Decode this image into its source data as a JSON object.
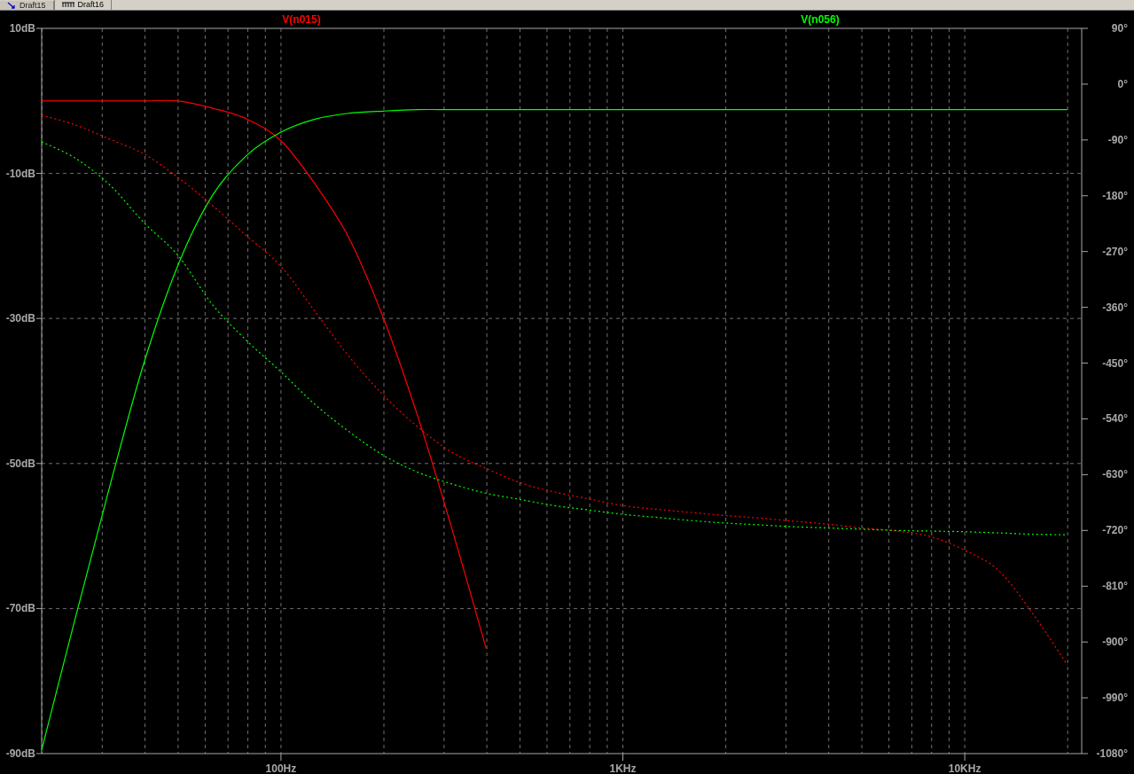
{
  "tabs": [
    {
      "label": "Draft15",
      "kind": "schematic",
      "selected": false
    },
    {
      "label": "Draft16",
      "kind": "netlist",
      "selected": true
    }
  ],
  "plot": {
    "magnitude": {
      "chart_data": {
        "type": "line",
        "grid": true,
        "ylim": [
          -90,
          10
        ],
        "yticks": [
          {
            "value": 10,
            "label": "10dB"
          },
          {
            "value": -10,
            "label": "-10dB"
          },
          {
            "value": -30,
            "label": "-30dB"
          },
          {
            "value": -50,
            "label": "-50dB"
          },
          {
            "value": -70,
            "label": "-70dB"
          },
          {
            "value": -90,
            "label": "-90dB"
          }
        ],
        "categories": [
          null,
          null,
          null,
          null,
          null,
          null,
          null,
          "100Hz",
          null,
          null,
          null,
          null,
          null,
          null,
          null,
          null,
          null,
          "1KHz",
          null,
          null,
          null,
          null,
          null,
          null,
          null,
          null,
          null,
          "10KHz",
          null,
          null,
          null
        ],
        "series": [
          {
            "name": "V(n015)",
            "color": "#ff0000",
            "values": [
              0,
              0,
              0,
              0,
              0,
              -1,
              -2.5,
              -5.5,
              -11.5,
              -19,
              -30,
              -43.5,
              -59,
              -75.5,
              null,
              null,
              null,
              null,
              null,
              null,
              null,
              null,
              null,
              null,
              null,
              null,
              null,
              null,
              null,
              null,
              null
            ]
          },
          {
            "name": "V(n056)",
            "color": "#00ff00",
            "values": [
              -89.5,
              -71,
              -53,
              -36,
              -22.5,
              -13,
              -7.5,
              -4.3,
              -2.5,
              -1.7,
              -1.4,
              -1.2,
              -1.2,
              -1.2,
              -1.2,
              -1.2,
              -1.2,
              -1.2,
              -1.2,
              -1.2,
              -1.2,
              -1.2,
              -1.2,
              -1.2,
              -1.2,
              -1.2,
              -1.2,
              -1.2,
              -1.2,
              -1.2,
              -1.2
            ]
          }
        ]
      }
    },
    "phase": {
      "chart_data": {
        "type": "line",
        "ylim": [
          -1080,
          90
        ],
        "yticks": [
          {
            "value": 90,
            "label": "90°"
          },
          {
            "value": 0,
            "label": "0°"
          },
          {
            "value": -90,
            "label": "-90°"
          },
          {
            "value": -180,
            "label": "-180°"
          },
          {
            "value": -270,
            "label": "-270°"
          },
          {
            "value": -360,
            "label": "-360°"
          },
          {
            "value": -450,
            "label": "-450°"
          },
          {
            "value": -540,
            "label": "-540°"
          },
          {
            "value": -630,
            "label": "-630°"
          },
          {
            "value": -720,
            "label": "-720°"
          },
          {
            "value": -810,
            "label": "-810°"
          },
          {
            "value": -900,
            "label": "-900°"
          },
          {
            "value": -990,
            "label": "-990°"
          },
          {
            "value": -1080,
            "label": "-1080°"
          }
        ],
        "series": [
          {
            "color": "#ff0000",
            "line_style": "dashed",
            "values": [
              -50,
              -66,
              -89,
              -113,
              -151,
              -196,
              -245,
              -294,
              -367,
              -440,
              -502,
              -553,
              -594,
              -620,
              -643,
              -658,
              -669,
              -680,
              -686,
              -691,
              -696,
              -700,
              -705,
              -710,
              -716,
              -721,
              -730,
              -752,
              -785,
              -855,
              -937
            ]
          },
          {
            "color": "#00ff00",
            "line_style": "dashed",
            "values": [
              -93,
              -120,
              -163,
              -224,
              -277,
              -356,
              -414,
              -464,
              -517,
              -561,
              -599,
              -626,
              -645,
              -660,
              -670,
              -680,
              -687,
              -694,
              -699,
              -704,
              -708,
              -711,
              -714,
              -716,
              -718,
              -720,
              -721,
              -722,
              -724,
              -726,
              -727
            ]
          }
        ]
      }
    }
  }
}
